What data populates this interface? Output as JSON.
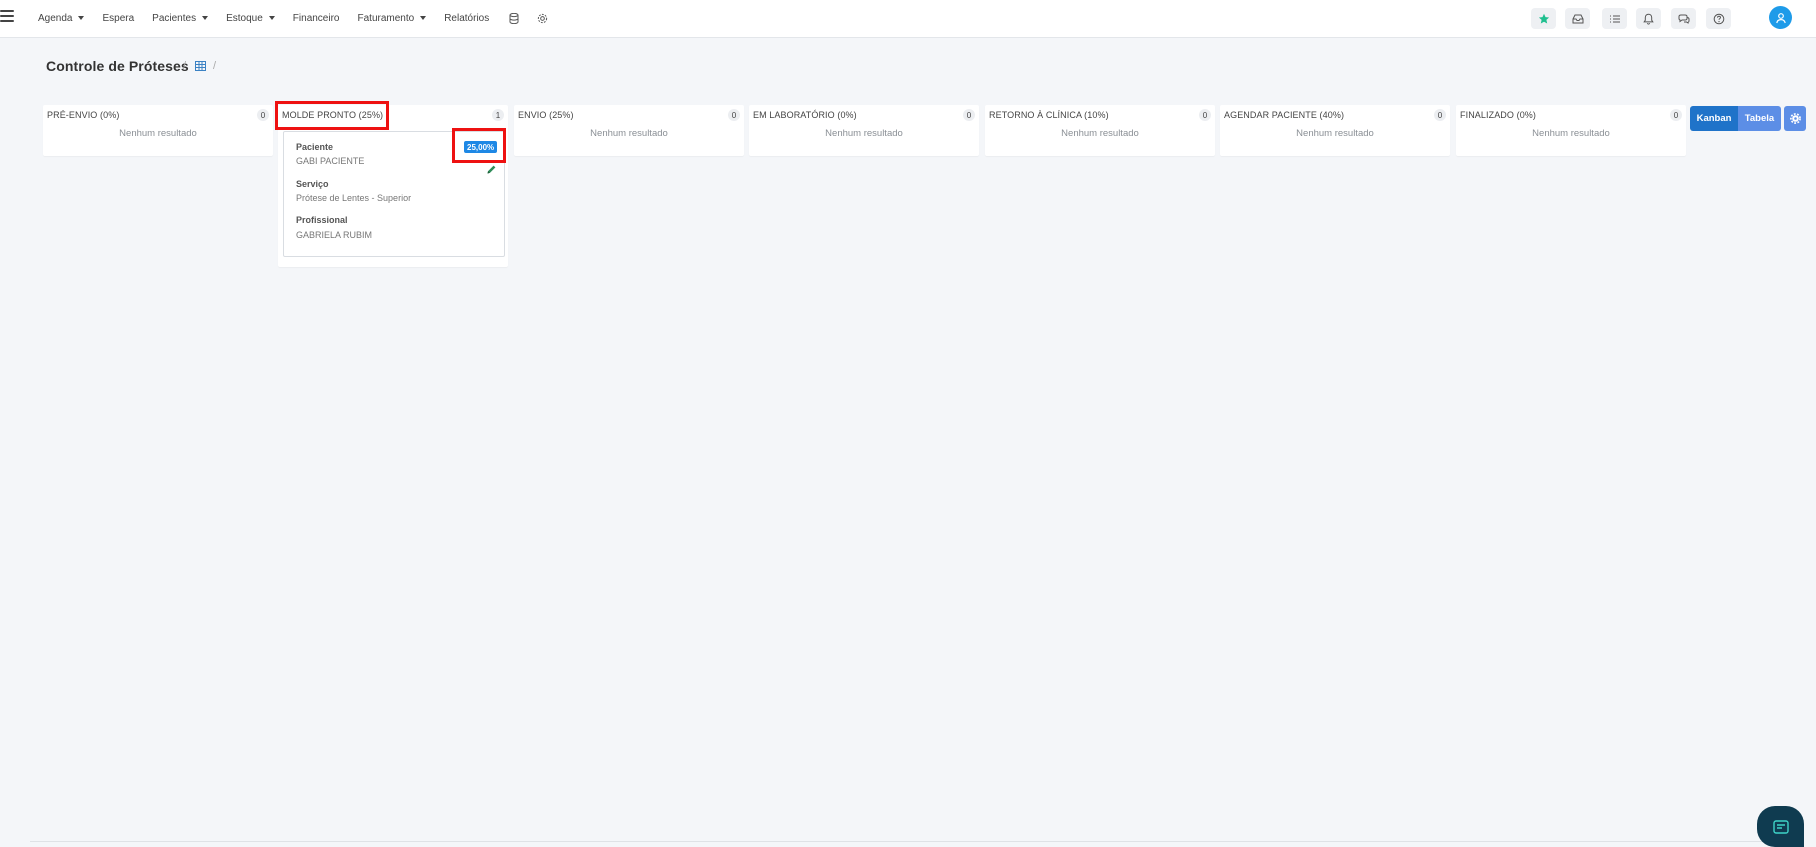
{
  "nav": {
    "items": [
      {
        "label": "Agenda",
        "dropdown": true
      },
      {
        "label": "Espera",
        "dropdown": false
      },
      {
        "label": "Pacientes",
        "dropdown": true
      },
      {
        "label": "Estoque",
        "dropdown": true
      },
      {
        "label": "Financeiro",
        "dropdown": false
      },
      {
        "label": "Faturamento",
        "dropdown": true
      },
      {
        "label": "Relatórios",
        "dropdown": false
      }
    ],
    "extra_icons": [
      "database-icon",
      "gear-icon"
    ],
    "right_icons": [
      "star-icon",
      "inbox-icon",
      "checklist-icon",
      "bell-icon",
      "chat-icon",
      "help-icon"
    ],
    "accent": "#1e9be9"
  },
  "page": {
    "title": "Controle de Próteses",
    "breadcrumb_sep": "/"
  },
  "columns": [
    {
      "title": "PRÉ-ENVIO (0%)",
      "count": "0",
      "empty_text": "Nenhum resultado"
    },
    {
      "title": "MOLDE PRONTO (25%)",
      "count": "1",
      "empty_text": ""
    },
    {
      "title": "ENVIO (25%)",
      "count": "0",
      "empty_text": "Nenhum resultado"
    },
    {
      "title": "EM LABORATÓRIO (0%)",
      "count": "0",
      "empty_text": "Nenhum resultado"
    },
    {
      "title": "RETORNO À CLÍNICA (10%)",
      "count": "0",
      "empty_text": "Nenhum resultado"
    },
    {
      "title": "AGENDAR PACIENTE (40%)",
      "count": "0",
      "empty_text": "Nenhum resultado"
    },
    {
      "title": "FINALIZADO (0%)",
      "count": "0",
      "empty_text": "Nenhum resultado"
    }
  ],
  "card": {
    "patient_label": "Paciente",
    "patient_value": "GABI PACIENTE",
    "percent": "25,00%",
    "service_label": "Serviço",
    "service_value": "Prótese de Lentes - Superior",
    "professional_label": "Profissional",
    "professional_value": "GABRIELA RUBIM"
  },
  "view_toggle": {
    "kanban_label": "Kanban",
    "tabela_label": "Tabela"
  }
}
